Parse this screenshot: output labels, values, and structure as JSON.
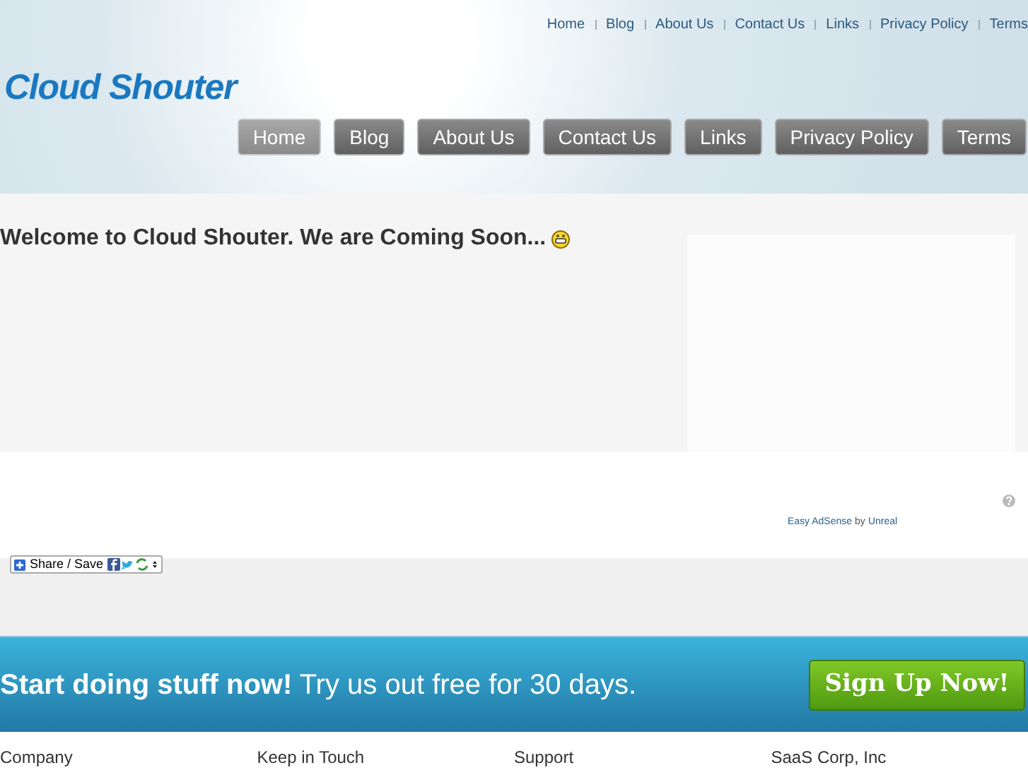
{
  "top_links": [
    "Home",
    "Blog",
    "About Us",
    "Contact Us",
    "Links",
    "Privacy Policy",
    "Terms"
  ],
  "logo": "Cloud Shouter",
  "nav": [
    {
      "label": "Home",
      "selected": true
    },
    {
      "label": "Blog",
      "selected": false
    },
    {
      "label": "About Us",
      "selected": false
    },
    {
      "label": "Contact Us",
      "selected": false
    },
    {
      "label": "Links",
      "selected": false
    },
    {
      "label": "Privacy Policy",
      "selected": false
    },
    {
      "label": "Terms",
      "selected": false
    }
  ],
  "heading": "Welcome to Cloud Shouter. We are Coming Soon...",
  "ad_credit": {
    "plugin": "Easy AdSense",
    "by": "by",
    "author": "Unreal"
  },
  "share_button": "Share / Save",
  "cta": {
    "text": "**Start doing stuff now!** Try us out free for 30 days.",
    "button": "Sign Up Now!"
  },
  "footer_headings": [
    "Company",
    "Keep in Touch",
    "Support",
    "SaaS Corp, Inc"
  ]
}
